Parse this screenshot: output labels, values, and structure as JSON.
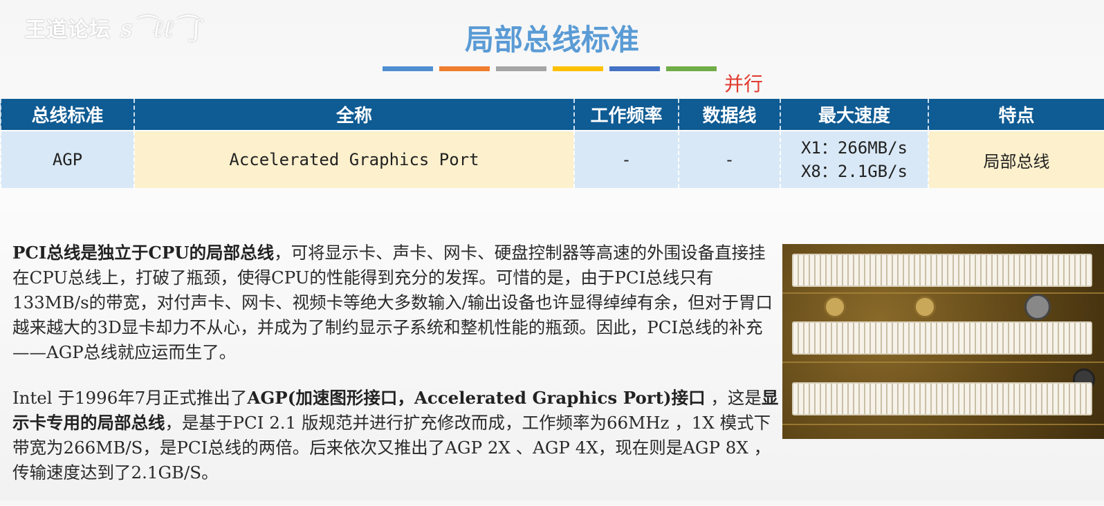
{
  "watermark": {
    "brand": "王道论坛",
    "signature": "Signature scribble"
  },
  "title": "局部总线标准",
  "accent_bar_colors": [
    "#4f8ed0",
    "#ee7d2e",
    "#a5a5a5",
    "#ffc000",
    "#4472c4",
    "#70ad47"
  ],
  "annotation": "并行",
  "table": {
    "headers": [
      "总线标准",
      "全称",
      "工作频率",
      "数据线",
      "最大速度",
      "特点"
    ],
    "row": {
      "standard": "AGP",
      "full_name": "Accelerated Graphics Port",
      "frequency": "-",
      "data_lines": "-",
      "max_speed_1": "X1：266MB/s",
      "max_speed_2": "X8：2.1GB/s",
      "feature": "局部总线"
    }
  },
  "paragraph1": {
    "bold_lead": "PCI总线是独立于CPU的局部总线",
    "rest": "，可将显示卡、声卡、网卡、硬盘控制器等高速的外围设备直接挂在CPU总线上，打破了瓶颈，使得CPU的性能得到充分的发挥。可惜的是，由于PCI总线只有133MB/s的带宽，对付声卡、网卡、视频卡等绝大多数输入/输出设备也许显得绰绰有余，但对于胃口越来越大的3D显卡却力不从心，并成为了制约显示子系统和整机性能的瓶颈。因此，PCI总线的补充——AGP总线就应运而生了。"
  },
  "paragraph2": {
    "part1": "Intel 于1996年7月正式推出了",
    "bold1": "AGP(加速图形接口，Accelerated Graphics Port)接口",
    "part2": " ，这是",
    "bold2": "显示卡专用的局部总线",
    "part3": "，是基于PCI 2.1 版规范并进行扩充修改而成，工作频率为66MHz ，1X 模式下带宽为266MB/S，是PCI总线的两倍。后来依次又推出了AGP 2X 、AGP 4X，现在则是AGP 8X ，传输速度达到了2.1GB/S。"
  },
  "photo": {
    "subject": "motherboard expansion slots photo"
  }
}
